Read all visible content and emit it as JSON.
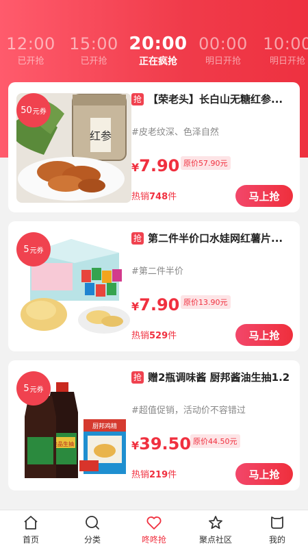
{
  "time_slots": [
    {
      "time": "12:00",
      "status": "已开抢"
    },
    {
      "time": "15:00",
      "status": "已开抢"
    },
    {
      "time": "20:00",
      "status": "正在疯抢"
    },
    {
      "time": "00:00",
      "status": "明日开抢"
    },
    {
      "time": "10:00",
      "status": "明日开抢"
    }
  ],
  "products": [
    {
      "coupon_value": "50",
      "coupon_unit": "元券",
      "badge": "抢",
      "title": "【荣老头】长白山无糖红参...",
      "tag": "#皮老纹深、色泽自然",
      "currency": "¥",
      "price": "7.90",
      "original_price": "原价57.90元",
      "sold_prefix": "热销",
      "sold_count": "748",
      "sold_suffix": "件",
      "buy_label": "马上抢"
    },
    {
      "coupon_value": "5",
      "coupon_unit": "元券",
      "badge": "抢",
      "title": "第二件半价口水娃网红薯片...",
      "tag": "#第二件半价",
      "currency": "¥",
      "price": "7.90",
      "original_price": "原价13.90元",
      "sold_prefix": "热销",
      "sold_count": "529",
      "sold_suffix": "件",
      "buy_label": "马上抢"
    },
    {
      "coupon_value": "5",
      "coupon_unit": "元券",
      "badge": "抢",
      "title": "赠2瓶调味酱 厨邦酱油生抽1.2",
      "tag": "#超值促销，活动价不容错过",
      "currency": "¥",
      "price": "39.50",
      "original_price": "原价44.50元",
      "sold_prefix": "热销",
      "sold_count": "219",
      "sold_suffix": "件",
      "buy_label": "马上抢"
    }
  ],
  "product_image_text": [
    "红参",
    "厨邦鸡精",
    "金品生抽",
    "厨邦"
  ],
  "tabs": [
    {
      "label": "首页",
      "icon": "home-icon"
    },
    {
      "label": "分类",
      "icon": "search-icon"
    },
    {
      "label": "咚咚抢",
      "icon": "heart-icon"
    },
    {
      "label": "聚点社区",
      "icon": "star-icon"
    },
    {
      "label": "我的",
      "icon": "profile-icon"
    }
  ],
  "colors": {
    "accent": "#f0303f",
    "header_start": "#ff5b6c",
    "header_end": "#ee3140"
  }
}
